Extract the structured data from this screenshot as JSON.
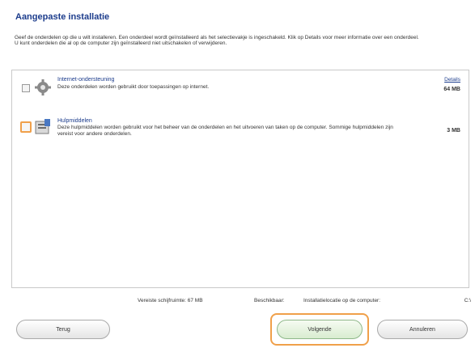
{
  "dialog": {
    "title": "Aangepaste installatie",
    "intro": [
      "Geef de onderdelen op die u wilt installeren. Een onderdeel wordt geïnstalleerd als het selectievakje is ingeschakeld. Klik op Details voor meer informatie over een onderdeel.",
      "U kunt onderdelen die al op de computer zijn geïnstalleerd niet uitschakelen of verwijderen."
    ]
  },
  "items": [
    {
      "name": "Internet-ondersteuning",
      "description": "Deze onderdelen worden gebruikt door toepassingen op internet.",
      "details": "Details",
      "size": "64 MB",
      "icon": "gear-icon",
      "checked": false
    },
    {
      "name": "Hulpmiddelen",
      "description": "Deze hulpmiddelen worden gebruikt voor het beheer van de onderdelen en het uitvoeren van taken op de computer. Sommige hulpmiddelen zijn vereist voor andere onderdelen.",
      "size": "3 MB",
      "icon": "tools-icon",
      "checked": false
    }
  ],
  "footer": {
    "required": "Vereiste schijfruimte: 67 MB",
    "available": "Beschikbaar:",
    "location": "Installatielocatie op de computer:",
    "drive": "C:\\"
  },
  "buttons": {
    "back": "Terug",
    "ok": "Volgende",
    "cancel": "Annuleren"
  },
  "colors": {
    "title": "#1c3c8c",
    "focus": "#f0a04a",
    "ok_button": "#d8ecd0"
  }
}
